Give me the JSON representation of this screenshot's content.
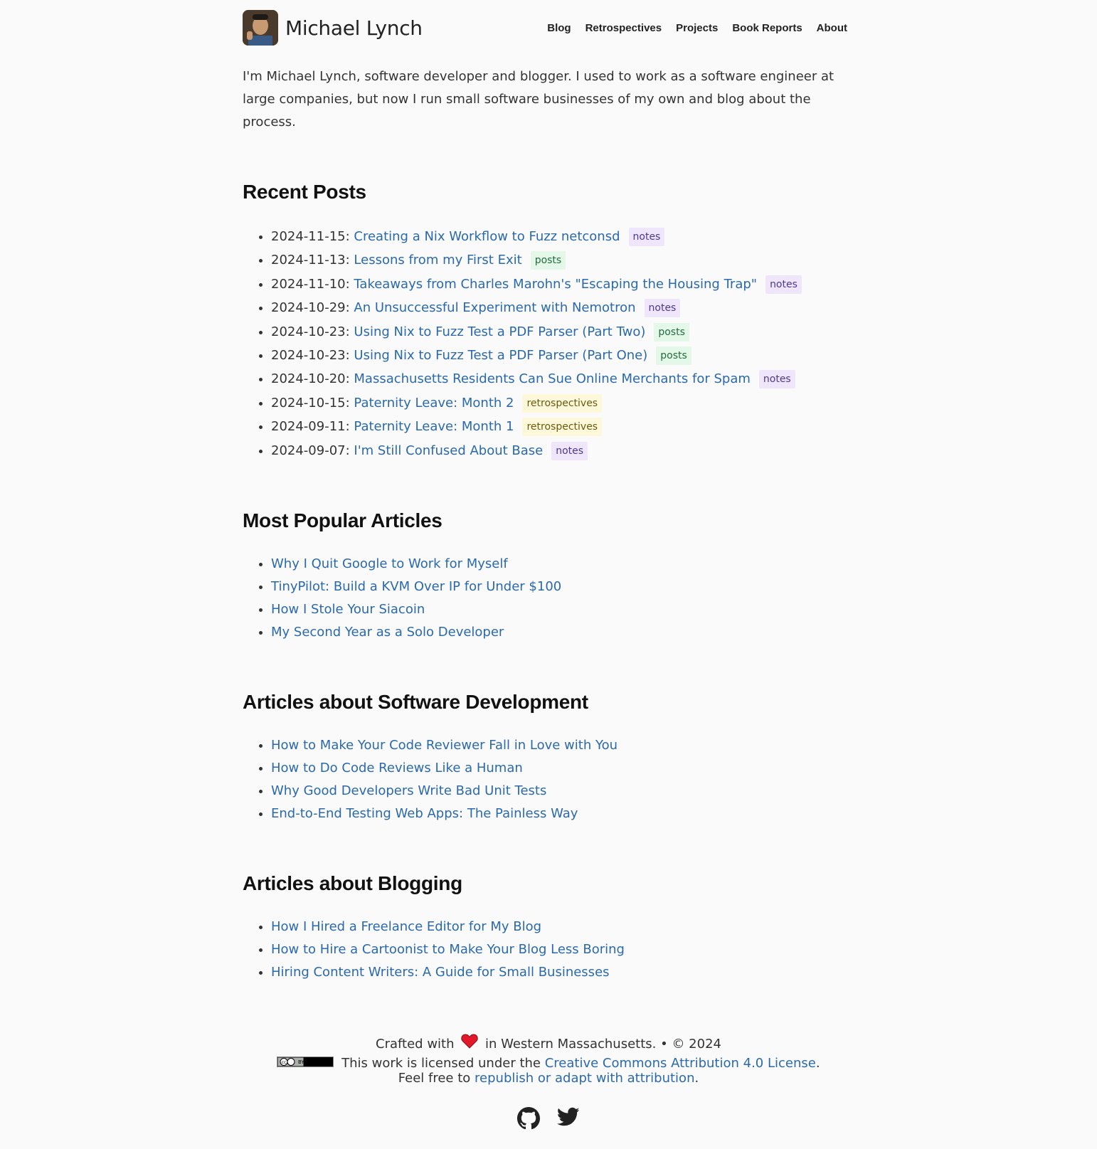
{
  "site": {
    "title": "Michael Lynch"
  },
  "nav": [
    "Blog",
    "Retrospectives",
    "Projects",
    "Book Reports",
    "About"
  ],
  "intro": "I'm Michael Lynch, software developer and blogger. I used to work as a software engineer at large companies, but now I run small software businesses of my own and blog about the process.",
  "recent": {
    "heading": "Recent Posts",
    "items": [
      {
        "date": "2024-11-15:",
        "title": "Creating a Nix Workflow to Fuzz netconsd",
        "tag": "notes"
      },
      {
        "date": "2024-11-13:",
        "title": "Lessons from my First Exit",
        "tag": "posts"
      },
      {
        "date": "2024-11-10:",
        "title": "Takeaways from Charles Marohn's \"Escaping the Housing Trap\"",
        "tag": "notes"
      },
      {
        "date": "2024-10-29:",
        "title": "An Unsuccessful Experiment with Nemotron",
        "tag": "notes"
      },
      {
        "date": "2024-10-23:",
        "title": "Using Nix to Fuzz Test a PDF Parser (Part Two)",
        "tag": "posts"
      },
      {
        "date": "2024-10-23:",
        "title": "Using Nix to Fuzz Test a PDF Parser (Part One)",
        "tag": "posts"
      },
      {
        "date": "2024-10-20:",
        "title": "Massachusetts Residents Can Sue Online Merchants for Spam",
        "tag": "notes"
      },
      {
        "date": "2024-10-15:",
        "title": "Paternity Leave: Month 2",
        "tag": "retrospectives"
      },
      {
        "date": "2024-09-11:",
        "title": "Paternity Leave: Month 1",
        "tag": "retrospectives"
      },
      {
        "date": "2024-09-07:",
        "title": "I'm Still Confused About Base",
        "tag": "notes"
      }
    ]
  },
  "popular": {
    "heading": "Most Popular Articles",
    "items": [
      "Why I Quit Google to Work for Myself",
      "TinyPilot: Build a KVM Over IP for Under $100",
      "How I Stole Your Siacoin",
      "My Second Year as a Solo Developer"
    ]
  },
  "software": {
    "heading": "Articles about Software Development",
    "items": [
      "How to Make Your Code Reviewer Fall in Love with You",
      "How to Do Code Reviews Like a Human",
      "Why Good Developers Write Bad Unit Tests",
      "End-to-End Testing Web Apps: The Painless Way"
    ]
  },
  "blogging": {
    "heading": "Articles about Blogging",
    "items": [
      "How I Hired a Freelance Editor for My Blog",
      "How to Hire a Cartoonist to Make Your Blog Less Boring",
      "Hiring Content Writers: A Guide for Small Businesses"
    ]
  },
  "footer": {
    "crafted_prefix": "Crafted with",
    "crafted_suffix": "in Western Massachusetts. • © 2024",
    "license_prefix": "This work is licensed under the",
    "license_link": "Creative Commons Attribution 4.0 License",
    "license_suffix": ".",
    "feel_prefix": "Feel free to",
    "feel_link": "republish or adapt with attribution",
    "feel_suffix": ".",
    "cc_badge_text": "BY"
  },
  "icons": {
    "heart": "heart-icon",
    "github": "github-icon",
    "twitter": "twitter-icon"
  },
  "colors": {
    "link": "#2a69ac",
    "background": "#fafafa",
    "notes_tag": "#efe6fb",
    "posts_tag": "#e3f8e8",
    "retro_tag": "#fdf8d9"
  }
}
